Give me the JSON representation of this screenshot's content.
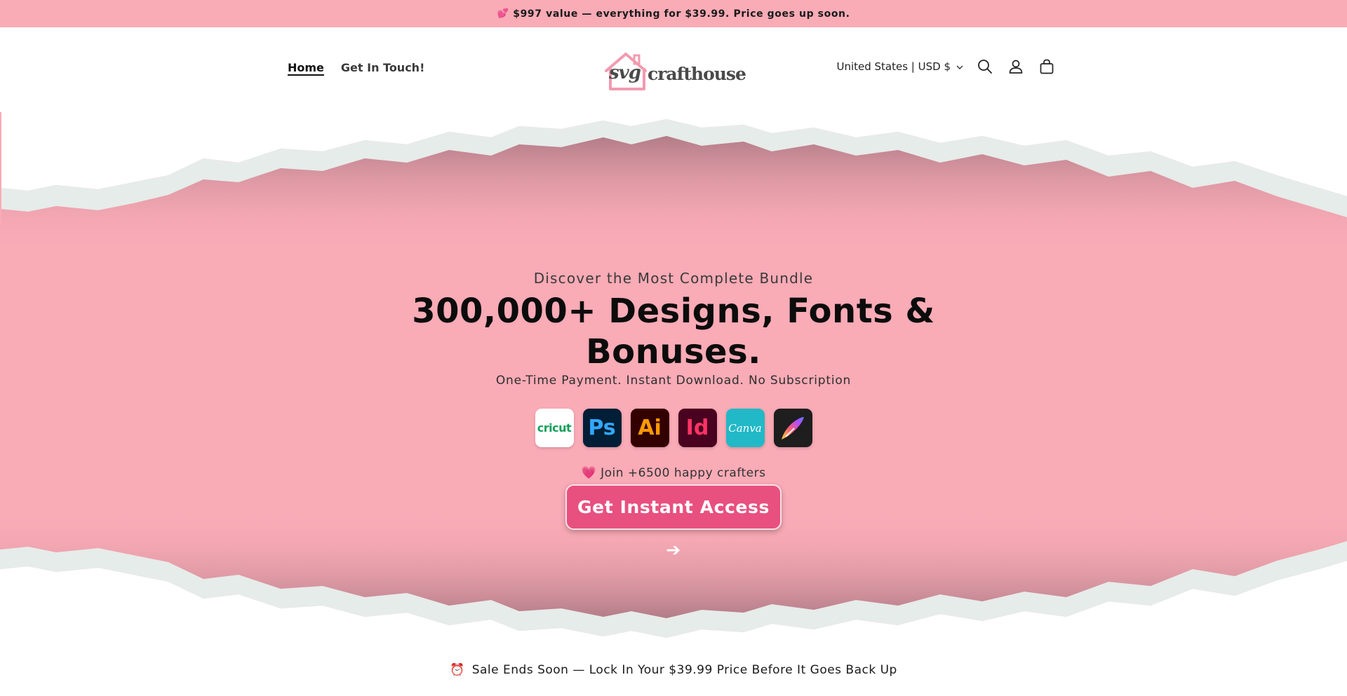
{
  "announcement": {
    "emoji": "💕",
    "text": "$997 value — everything for $39.99. Price goes up soon."
  },
  "nav": {
    "items": [
      {
        "label": "Home",
        "active": true
      },
      {
        "label": "Get In Touch!",
        "active": false
      }
    ]
  },
  "logo": {
    "svg_text": "svg",
    "craft_text": "crafthouse"
  },
  "header": {
    "country_selector": "United States | USD $",
    "icons": [
      "search-icon",
      "account-icon",
      "cart-icon"
    ]
  },
  "hero": {
    "subtitle": "Discover the Most Complete Bundle",
    "title_line1": "300,000+ Designs, Fonts &",
    "title_line2": "Bonuses.",
    "tagline": "One-Time Payment. Instant Download. No Subscription",
    "apps": [
      {
        "name": "cricut-icon",
        "label": "cricut"
      },
      {
        "name": "photoshop-icon",
        "label": "Ps"
      },
      {
        "name": "illustrator-icon",
        "label": "Ai"
      },
      {
        "name": "indesign-icon",
        "label": "Id"
      },
      {
        "name": "canva-icon",
        "label": "Canva"
      },
      {
        "name": "procreate-icon",
        "label": ""
      }
    ],
    "join_emoji": "💗",
    "join_text": "Join +6500 happy crafters",
    "cta_label": "Get Instant Access ➔"
  },
  "sale_banner": {
    "emoji": "⏰",
    "text": "Sale Ends Soon — Lock In Your $39.99 Price Before It Goes Back Up"
  },
  "colors": {
    "brand_pink": "#f9abb6",
    "cta_pink": "#e8507f",
    "text_dark": "#0c0c0c"
  }
}
